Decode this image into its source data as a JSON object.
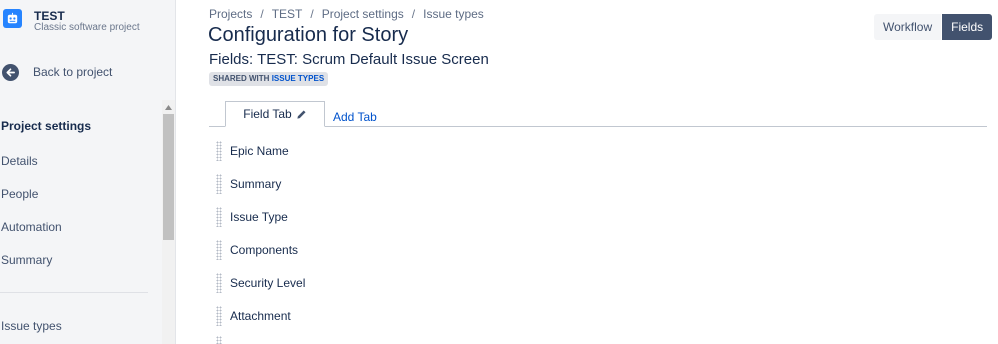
{
  "sidebar": {
    "project_name": "TEST",
    "project_type": "Classic software project",
    "back_label": "Back to project",
    "heading": "Project settings",
    "items": [
      {
        "label": "Details"
      },
      {
        "label": "People"
      },
      {
        "label": "Automation"
      },
      {
        "label": "Summary"
      },
      {
        "label": "Issue types"
      }
    ]
  },
  "breadcrumb": [
    "Projects",
    "TEST",
    "Project settings",
    "Issue types"
  ],
  "page": {
    "title": "Configuration for Story",
    "subtitle": "Fields: TEST: Scrum Default Issue Screen",
    "shared_prefix": "SHARED WITH",
    "shared_link": "ISSUE TYPES"
  },
  "view_switch": {
    "workflow": "Workflow",
    "fields": "Fields"
  },
  "tabs": {
    "active_tab": "Field Tab",
    "add_tab": "Add Tab"
  },
  "fields": [
    {
      "label": "Epic Name"
    },
    {
      "label": "Summary"
    },
    {
      "label": "Issue Type"
    },
    {
      "label": "Components"
    },
    {
      "label": "Security Level"
    },
    {
      "label": "Attachment"
    }
  ],
  "colors": {
    "accent": "#0052cc",
    "active_button": "#42526e",
    "project_avatar": "#2684ff"
  }
}
